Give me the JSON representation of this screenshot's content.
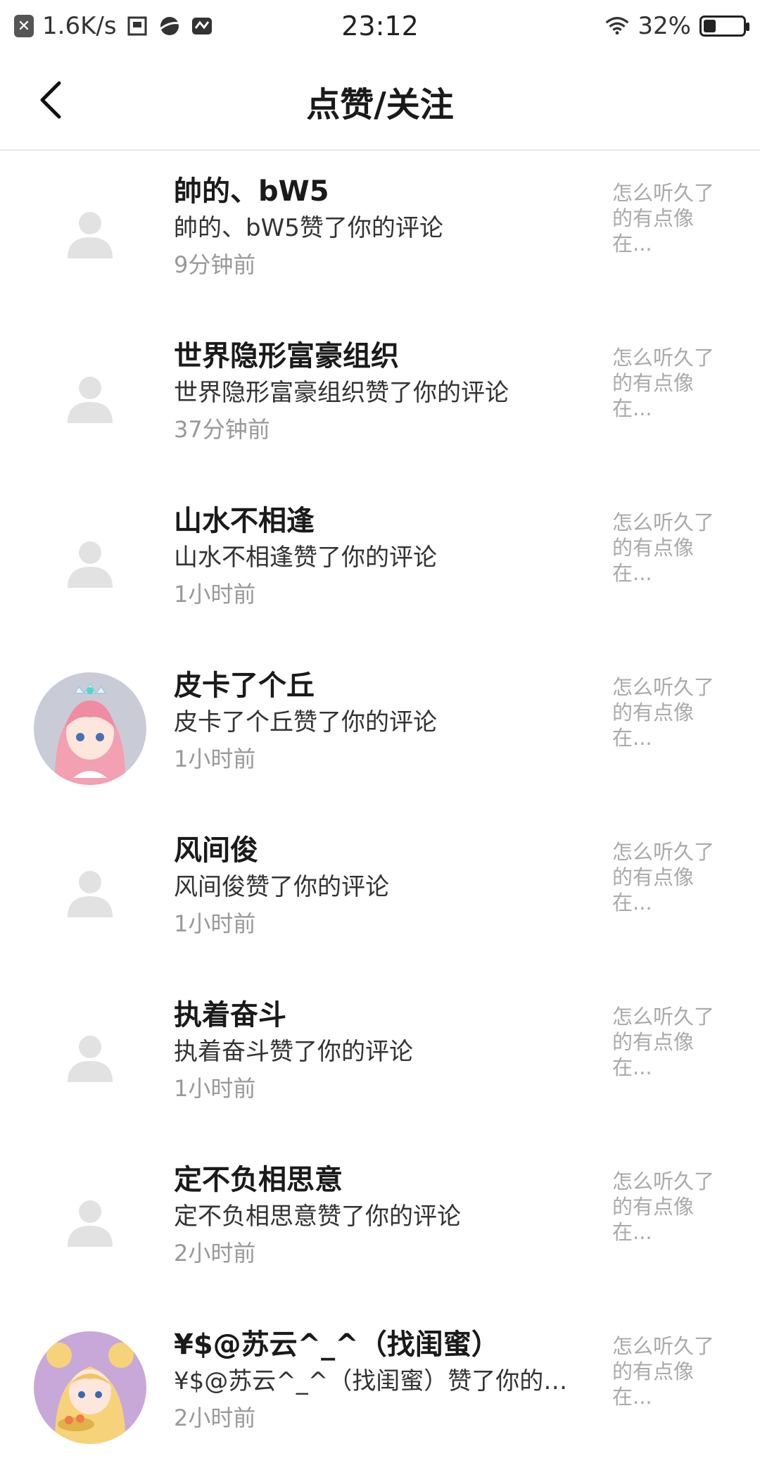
{
  "status_bar": {
    "speed": "1.6K/s",
    "time": "23:12",
    "battery": "32%",
    "battery_level": 0.32
  },
  "header": {
    "title": "点赞/关注"
  },
  "items": [
    {
      "name": "帥的、bW5",
      "message": "帥的、bW5赞了你的评论",
      "time": "9分钟前",
      "quote": "怎么听久了的有点像在...",
      "avatar": "placeholder"
    },
    {
      "name": "世界隐形富豪组织",
      "message": "世界隐形富豪组织赞了你的评论",
      "time": "37分钟前",
      "quote": "怎么听久了的有点像在...",
      "avatar": "placeholder"
    },
    {
      "name": "山水不相逢",
      "message": "山水不相逢赞了你的评论",
      "time": "1小时前",
      "quote": "怎么听久了的有点像在...",
      "avatar": "placeholder"
    },
    {
      "name": "皮卡了个丘",
      "message": "皮卡了个丘赞了你的评论",
      "time": "1小时前",
      "quote": "怎么听久了的有点像在...",
      "avatar": "anime-pink"
    },
    {
      "name": "风间俊",
      "message": "风间俊赞了你的评论",
      "time": "1小时前",
      "quote": "怎么听久了的有点像在...",
      "avatar": "placeholder"
    },
    {
      "name": "执着奋斗",
      "message": "执着奋斗赞了你的评论",
      "time": "1小时前",
      "quote": "怎么听久了的有点像在...",
      "avatar": "placeholder"
    },
    {
      "name": "定不负相思意",
      "message": "定不负相思意赞了你的评论",
      "time": "2小时前",
      "quote": "怎么听久了的有点像在...",
      "avatar": "placeholder"
    },
    {
      "name": "¥$@苏云^_^（找闺蜜）",
      "message": "¥$@苏云^_^（找闺蜜）赞了你的…",
      "time": "2小时前",
      "quote": "怎么听久了的有点像在...",
      "avatar": "anime-sailor"
    }
  ]
}
